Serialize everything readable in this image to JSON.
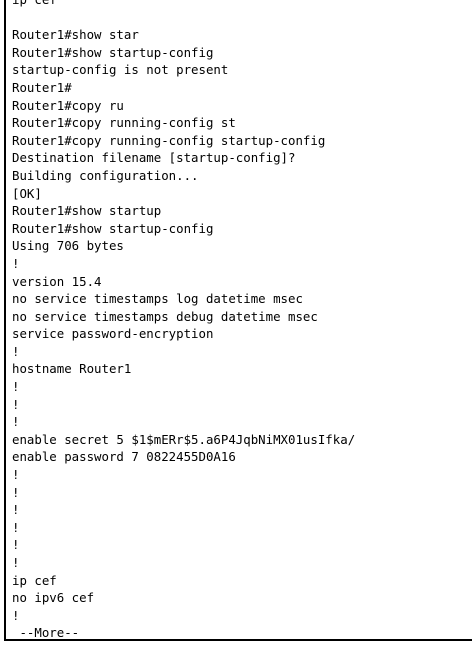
{
  "terminal": {
    "lines": [
      "ip cef",
      "",
      "Router1#show star",
      "Router1#show startup-config",
      "startup-config is not present",
      "Router1#",
      "Router1#copy ru",
      "Router1#copy running-config st",
      "Router1#copy running-config startup-config",
      "Destination filename [startup-config]?",
      "Building configuration...",
      "[OK]",
      "Router1#show startup",
      "Router1#show startup-config",
      "Using 706 bytes",
      "!",
      "version 15.4",
      "no service timestamps log datetime msec",
      "no service timestamps debug datetime msec",
      "service password-encryption",
      "!",
      "hostname Router1",
      "!",
      "!",
      "!",
      "enable secret 5 $1$mERr$5.a6P4JqbNiMX01usIfka/",
      "enable password 7 0822455D0A16",
      "!",
      "!",
      "!",
      "!",
      "!",
      "!",
      "ip cef",
      "no ipv6 cef",
      "!",
      " --More--"
    ]
  }
}
